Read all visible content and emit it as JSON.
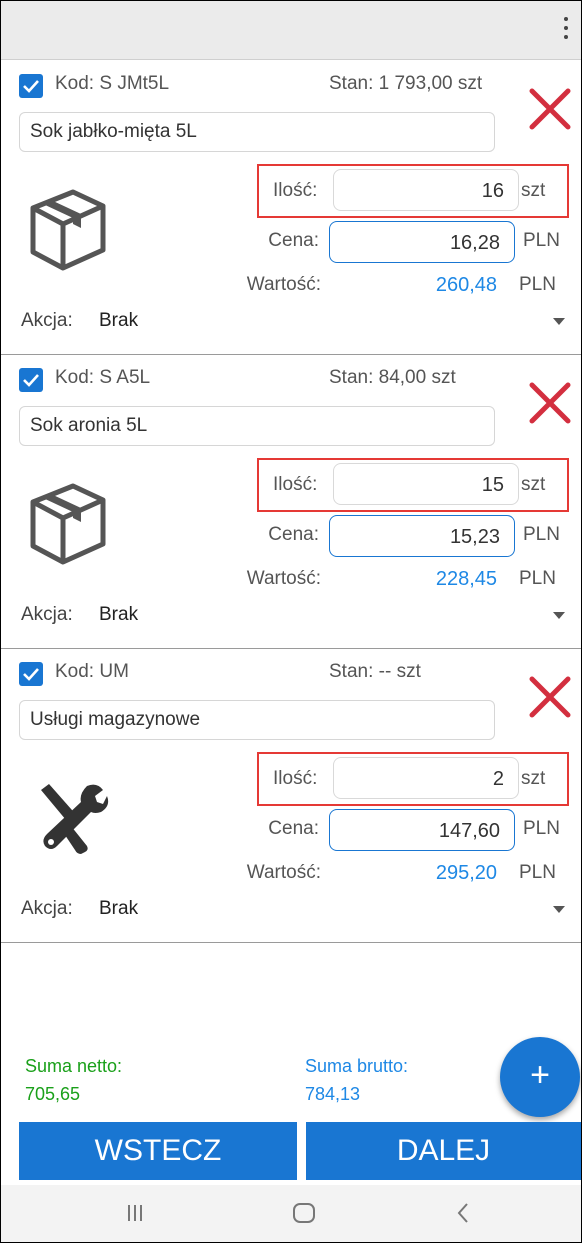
{
  "items": [
    {
      "kod": "Kod: S JMt5L",
      "stan": "Stan: 1 793,00 szt",
      "name": "Sok jabłko-mięta 5L",
      "ilosc_label": "Ilość:",
      "ilosc": "16",
      "ilosc_unit": "szt",
      "cena_label": "Cena:",
      "cena": "16,28",
      "cena_unit": "PLN",
      "wartosc_label": "Wartość:",
      "wartosc": "260,48",
      "wartosc_unit": "PLN",
      "akcja_label": "Akcja:",
      "akcja": "Brak",
      "icon": "box-icon"
    },
    {
      "kod": "Kod: S A5L",
      "stan": "Stan: 84,00 szt",
      "name": "Sok aronia 5L",
      "ilosc_label": "Ilość:",
      "ilosc": "15",
      "ilosc_unit": "szt",
      "cena_label": "Cena:",
      "cena": "15,23",
      "cena_unit": "PLN",
      "wartosc_label": "Wartość:",
      "wartosc": "228,45",
      "wartosc_unit": "PLN",
      "akcja_label": "Akcja:",
      "akcja": "Brak",
      "icon": "box-icon"
    },
    {
      "kod": "Kod: UM",
      "stan": "Stan: -- szt",
      "name": "Usługi magazynowe",
      "ilosc_label": "Ilość:",
      "ilosc": "2",
      "ilosc_unit": "szt",
      "cena_label": "Cena:",
      "cena": "147,60",
      "cena_unit": "PLN",
      "wartosc_label": "Wartość:",
      "wartosc": "295,20",
      "wartosc_unit": "PLN",
      "akcja_label": "Akcja:",
      "akcja": "Brak",
      "icon": "tools-icon"
    }
  ],
  "summary": {
    "netto_label": "Suma netto:",
    "netto": "705,65",
    "brutto_label": "Suma brutto:",
    "brutto": "784,13"
  },
  "buttons": {
    "back": "WSTECZ",
    "next": "DALEJ",
    "add": "+"
  },
  "colors": {
    "primary": "#1976d2",
    "value_blue": "#1e88e5",
    "netto_green": "#1aa01a",
    "delete_red": "#d32f3f",
    "highlight_red": "#e53935"
  },
  "icons": {
    "menu": "more-vert-icon",
    "delete": "close-icon",
    "add": "plus-icon",
    "nav": [
      "recent-apps-icon",
      "home-icon",
      "back-icon"
    ]
  }
}
